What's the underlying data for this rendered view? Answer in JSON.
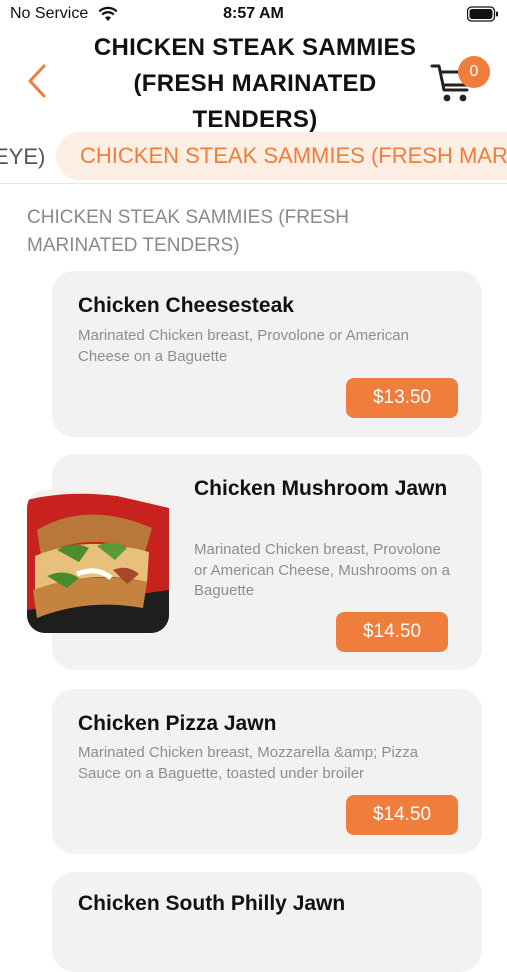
{
  "status_bar": {
    "carrier": "No Service",
    "time": "8:57 AM"
  },
  "header": {
    "title": "CHICKEN STEAK SAMMIES (FRESH MARINATED TENDERS)",
    "cart_count": "0"
  },
  "tabs": {
    "previous_partial": "EYE)",
    "active": "CHICKEN STEAK SAMMIES (FRESH MARINATED TENDERS)"
  },
  "section_title": "CHICKEN STEAK SAMMIES (FRESH MARINATED TENDERS)",
  "items": [
    {
      "name": "Chicken Cheesesteak",
      "description": "Marinated Chicken breast, Provolone or American Cheese on a Baguette",
      "price": "$13.50"
    },
    {
      "name": "Chicken Mushroom Jawn",
      "description": "Marinated Chicken breast, Provolone or American Cheese, Mushrooms on a Baguette",
      "price": "$14.50"
    },
    {
      "name": "Chicken Pizza Jawn",
      "description": "Marinated Chicken breast, Mozzarella &amp; Pizza Sauce on a Baguette, toasted under broiler",
      "price": "$14.50"
    },
    {
      "name": "Chicken South Philly Jawn"
    }
  ],
  "colors": {
    "accent": "#ef7d3c",
    "tab_bg": "#fdeee3",
    "card_bg": "#f2f2f2"
  }
}
